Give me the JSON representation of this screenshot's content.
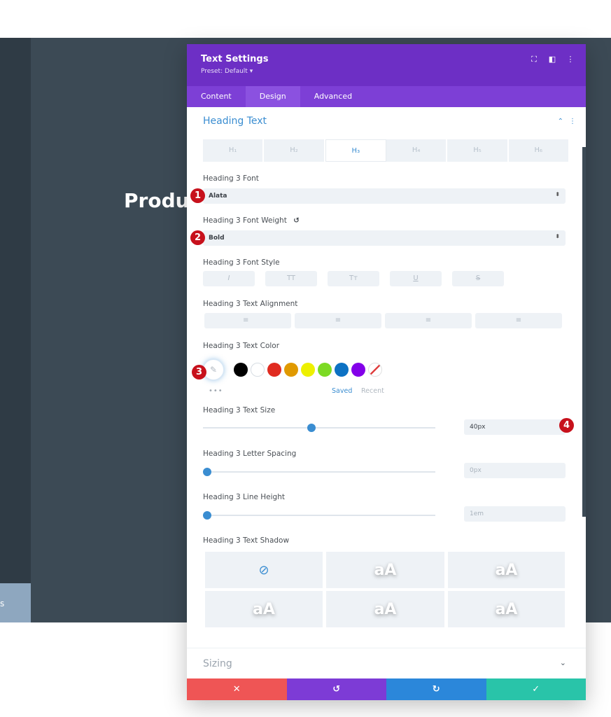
{
  "background": {
    "heading_fragment": "Produc",
    "side_tab_label": "s"
  },
  "modal": {
    "title": "Text Settings",
    "preset": "Preset: Default ▾",
    "header_icons": [
      "⛶",
      "◧",
      "⋮"
    ],
    "tabs": [
      {
        "label": "Content",
        "active": false
      },
      {
        "label": "Design",
        "active": true
      },
      {
        "label": "Advanced",
        "active": false
      }
    ],
    "section_title": "Heading Text",
    "section_controls": [
      "⌃",
      "⋮"
    ],
    "heading_tabs": [
      "H₁",
      "H₂",
      "H₃",
      "H₄",
      "H₅",
      "H₆"
    ],
    "active_heading": "H₃",
    "font": {
      "label": "Heading 3 Font",
      "value": "Alata"
    },
    "font_weight": {
      "label": "Heading 3 Font Weight",
      "value": "Bold",
      "reset_icon": "↺"
    },
    "font_style": {
      "label": "Heading 3 Font Style",
      "buttons": [
        "I",
        "TT",
        "Tт",
        "U",
        "S"
      ]
    },
    "text_alignment": {
      "label": "Heading 3 Text Alignment",
      "buttons": [
        "≡",
        "≡",
        "≡",
        "≡"
      ]
    },
    "text_color": {
      "label": "Heading 3 Text Color",
      "picker_icon": "✎",
      "swatches": [
        "#000000",
        "#ffffff",
        "#e02b20",
        "#e09900",
        "#edf000",
        "#7cda24",
        "#0c71c3",
        "#8300e9"
      ],
      "dots": "•••",
      "saved_label": "Saved",
      "recent_label": "Recent"
    },
    "text_size": {
      "label": "Heading 3 Text Size",
      "value": "40px",
      "slider_fraction": 0.4
    },
    "letter_spacing": {
      "label": "Heading 3 Letter Spacing",
      "value": "0px",
      "slider_fraction": 0
    },
    "line_height": {
      "label": "Heading 3 Line Height",
      "value": "1em",
      "slider_fraction": 0
    },
    "text_shadow": {
      "label": "Heading 3 Text Shadow",
      "none_icon": "⃠",
      "preview_text": "aA"
    },
    "sizing_title": "Sizing",
    "sizing_chevron": "⌄",
    "footer": {
      "cancel": "✕",
      "undo": "↺",
      "redo": "↻",
      "save": "✓"
    }
  },
  "badges": [
    "1",
    "2",
    "3",
    "4"
  ],
  "colors": {
    "header_purple": "#6d2fc5",
    "tabs_purple": "#7d3fd6",
    "accent_blue": "#3a8dd1",
    "badge_red": "#c7111c",
    "footer_red": "#ef5555",
    "footer_purple": "#7d3bd6",
    "footer_blue": "#2b87da",
    "footer_green": "#29c4a9"
  }
}
